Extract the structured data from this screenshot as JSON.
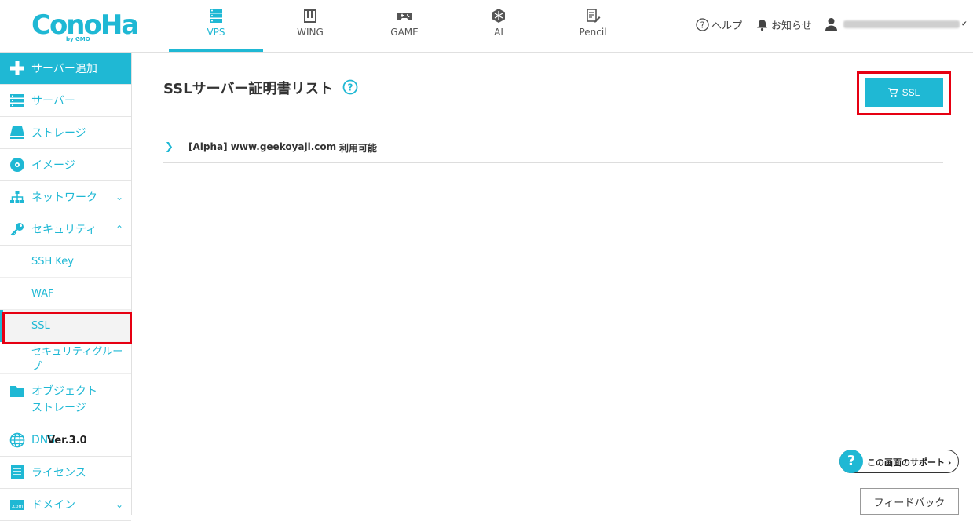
{
  "header": {
    "logo_text": "ConoHa",
    "logo_by": "by GMO",
    "tabs": [
      {
        "label": "VPS",
        "icon": "server-icon"
      },
      {
        "label": "WING",
        "icon": "wing-icon"
      },
      {
        "label": "GAME",
        "icon": "gamepad-icon"
      },
      {
        "label": "AI",
        "icon": "ai-icon"
      },
      {
        "label": "Pencil",
        "icon": "pencil-icon"
      }
    ],
    "help_label": "ヘルプ",
    "notice_label": "お知らせ"
  },
  "sidebar": {
    "items": [
      {
        "label": "サーバー追加"
      },
      {
        "label": "サーバー"
      },
      {
        "label": "ストレージ"
      },
      {
        "label": "イメージ"
      },
      {
        "label": "ネットワーク"
      },
      {
        "label": "セキュリティ"
      },
      {
        "label": "オブジェクト"
      },
      {
        "label": "ストレージ"
      },
      {
        "label": "DNS"
      },
      {
        "label": "ライセンス"
      },
      {
        "label": "ドメイン"
      }
    ],
    "security_sub": [
      {
        "label": "SSH Key"
      },
      {
        "label": "WAF"
      },
      {
        "label": "SSL"
      },
      {
        "label": "セキュリティグループ"
      }
    ],
    "version": "Ver.3.0"
  },
  "main": {
    "title": "SSLサーバー証明書リスト",
    "order_button": "SSL",
    "certificates": [
      {
        "name": "[Alpha] www.geekoyaji.com",
        "status": "利用可能"
      }
    ]
  },
  "footer": {
    "support_label": "この画面のサポート",
    "feedback_label": "フィードバック"
  },
  "colors": {
    "accent": "#1fb8d4",
    "highlight": "#e60012"
  }
}
